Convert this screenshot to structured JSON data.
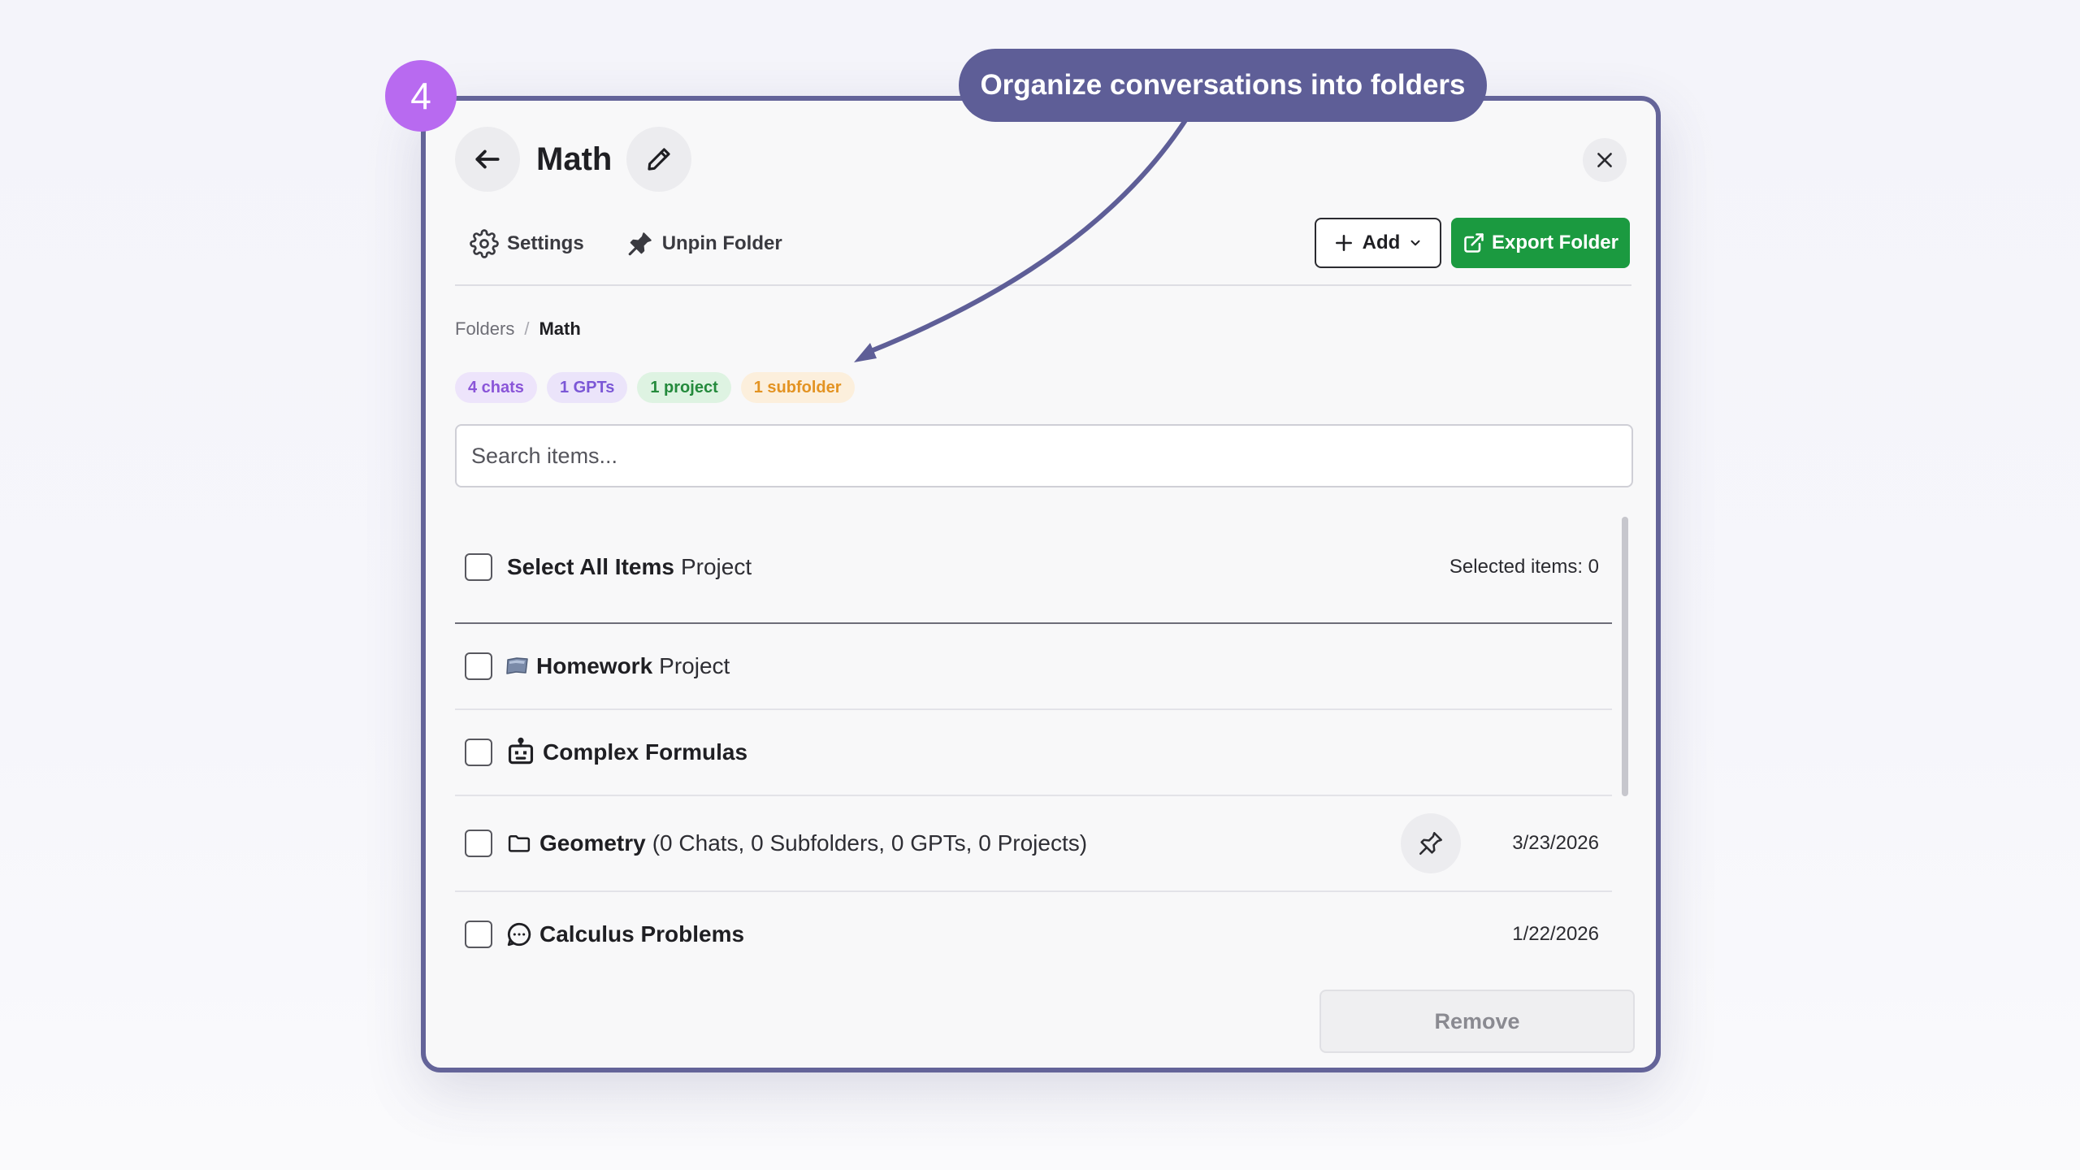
{
  "step_number": "4",
  "callout": {
    "text": "Organize conversations into folders"
  },
  "header": {
    "title": "Math"
  },
  "toolbar": {
    "settings_label": "Settings",
    "unpin_label": "Unpin Folder",
    "add_label": "Add",
    "export_label": "Export Folder"
  },
  "breadcrumb": {
    "root": "Folders",
    "separator": "/",
    "current": "Math"
  },
  "pills": [
    {
      "label": "4 chats",
      "bg": "#ede4fb",
      "color": "#8a55d8"
    },
    {
      "label": "1 GPTs",
      "bg": "#ebe4fa",
      "color": "#7b57d6"
    },
    {
      "label": "1 project",
      "bg": "#def3e2",
      "color": "#248a3c"
    },
    {
      "label": "1 subfolder",
      "bg": "#fcefdc",
      "color": "#e39322"
    }
  ],
  "search": {
    "placeholder": "Search items...",
    "value": ""
  },
  "list": {
    "header": {
      "select_all": "Select All Items",
      "select_all_suffix": "Project",
      "selected_count": "Selected items: 0"
    },
    "items": [
      {
        "type": "project",
        "icon": "folder-flag-icon",
        "name": "Homework",
        "suffix": "Project",
        "date": ""
      },
      {
        "type": "gpt",
        "icon": "robot-icon",
        "name": "Complex Formulas",
        "suffix": "",
        "date": ""
      },
      {
        "type": "folder",
        "icon": "folder-icon",
        "name": "Geometry",
        "suffix": "(0 Chats, 0 Subfolders, 0 GPTs, 0 Projects)",
        "date": "3/23/2026",
        "pin": "pin-icon"
      },
      {
        "type": "chat",
        "icon": "chat-bubble-icon",
        "name": "Calculus Problems",
        "suffix": "",
        "date": "1/22/2026"
      }
    ]
  },
  "footer": {
    "remove_label": "Remove"
  },
  "colors": {
    "accent": "#646499",
    "callout": "#5e5e97",
    "badge": "#b86af0",
    "export_button": "#1b9a40"
  }
}
